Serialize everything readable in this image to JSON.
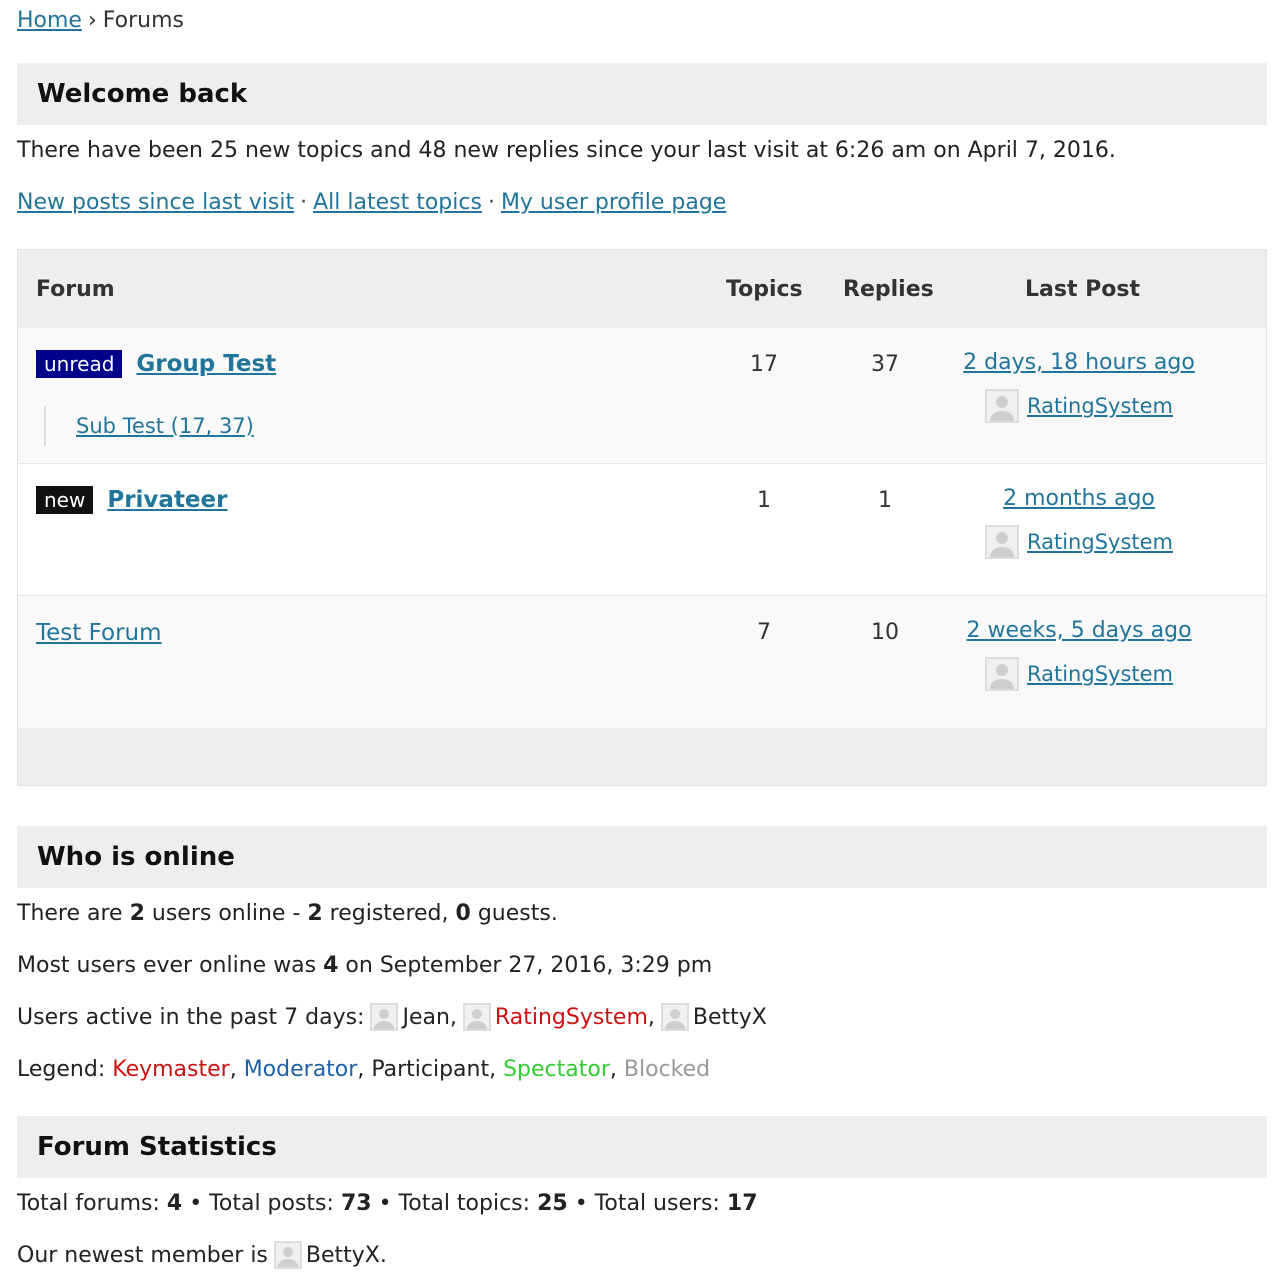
{
  "breadcrumb": {
    "home": "Home",
    "separator": "›",
    "current": "Forums"
  },
  "welcome": {
    "title": "Welcome back",
    "message": "There have been 25 new topics and 48 new replies since your last visit at 6:26 am on April 7, 2016.",
    "links": [
      "New posts since last visit",
      "All latest topics",
      "My user profile page"
    ],
    "link_separator": "·"
  },
  "forum_table": {
    "headers": {
      "forum": "Forum",
      "topics": "Topics",
      "replies": "Replies",
      "last_post": "Last Post"
    },
    "rows": [
      {
        "badge": "unread",
        "title": "Group Test",
        "subforum": "Sub Test (17, 37)",
        "topics": "17",
        "replies": "37",
        "last_time": "2 days, 18 hours ago",
        "last_user": "RatingSystem"
      },
      {
        "badge": "new",
        "title": "Privateer",
        "topics": "1",
        "replies": "1",
        "last_time": "2 months ago",
        "last_user": "RatingSystem"
      },
      {
        "title": "Test Forum",
        "topics": "7",
        "replies": "10",
        "last_time": "2 weeks, 5 days ago",
        "last_user": "RatingSystem"
      }
    ]
  },
  "online": {
    "title": "Who is online",
    "users_line": {
      "p1": "There are ",
      "total": "2",
      "p2": " users online - ",
      "registered": "2",
      "p3": " registered, ",
      "guests": "0",
      "p4": " guests."
    },
    "most_line": {
      "p1": "Most users ever online was ",
      "count": "4",
      "p2": " on September 27, 2016, 3:29 pm"
    },
    "active_label": "Users active in the past 7 days:",
    "active_users": [
      "Jean",
      "RatingSystem",
      "BettyX"
    ],
    "legend_label": "Legend:",
    "legend": [
      "Keymaster",
      "Moderator",
      "Participant",
      "Spectator",
      "Blocked"
    ],
    "legend_colors": {
      "keymaster": "#cc1111",
      "moderator": "#1d62a8",
      "participant": "#222222",
      "spectator": "#33cc33",
      "blocked": "#999999"
    }
  },
  "stats": {
    "title": "Forum Statistics",
    "forums_label": "Total forums:",
    "forums": "4",
    "posts_label": "Total posts:",
    "posts": "73",
    "topics_label": "Total topics:",
    "topics": "25",
    "users_label": "Total users:",
    "users": "17",
    "bullet": "•",
    "newest_label": "Our newest member is",
    "newest_member": "BettyX",
    "newest_suffix": "."
  },
  "colors": {
    "link": "#21759b",
    "section_bg": "#eeeeee",
    "unread_badge": "#00008b",
    "new_badge": "#111111"
  }
}
